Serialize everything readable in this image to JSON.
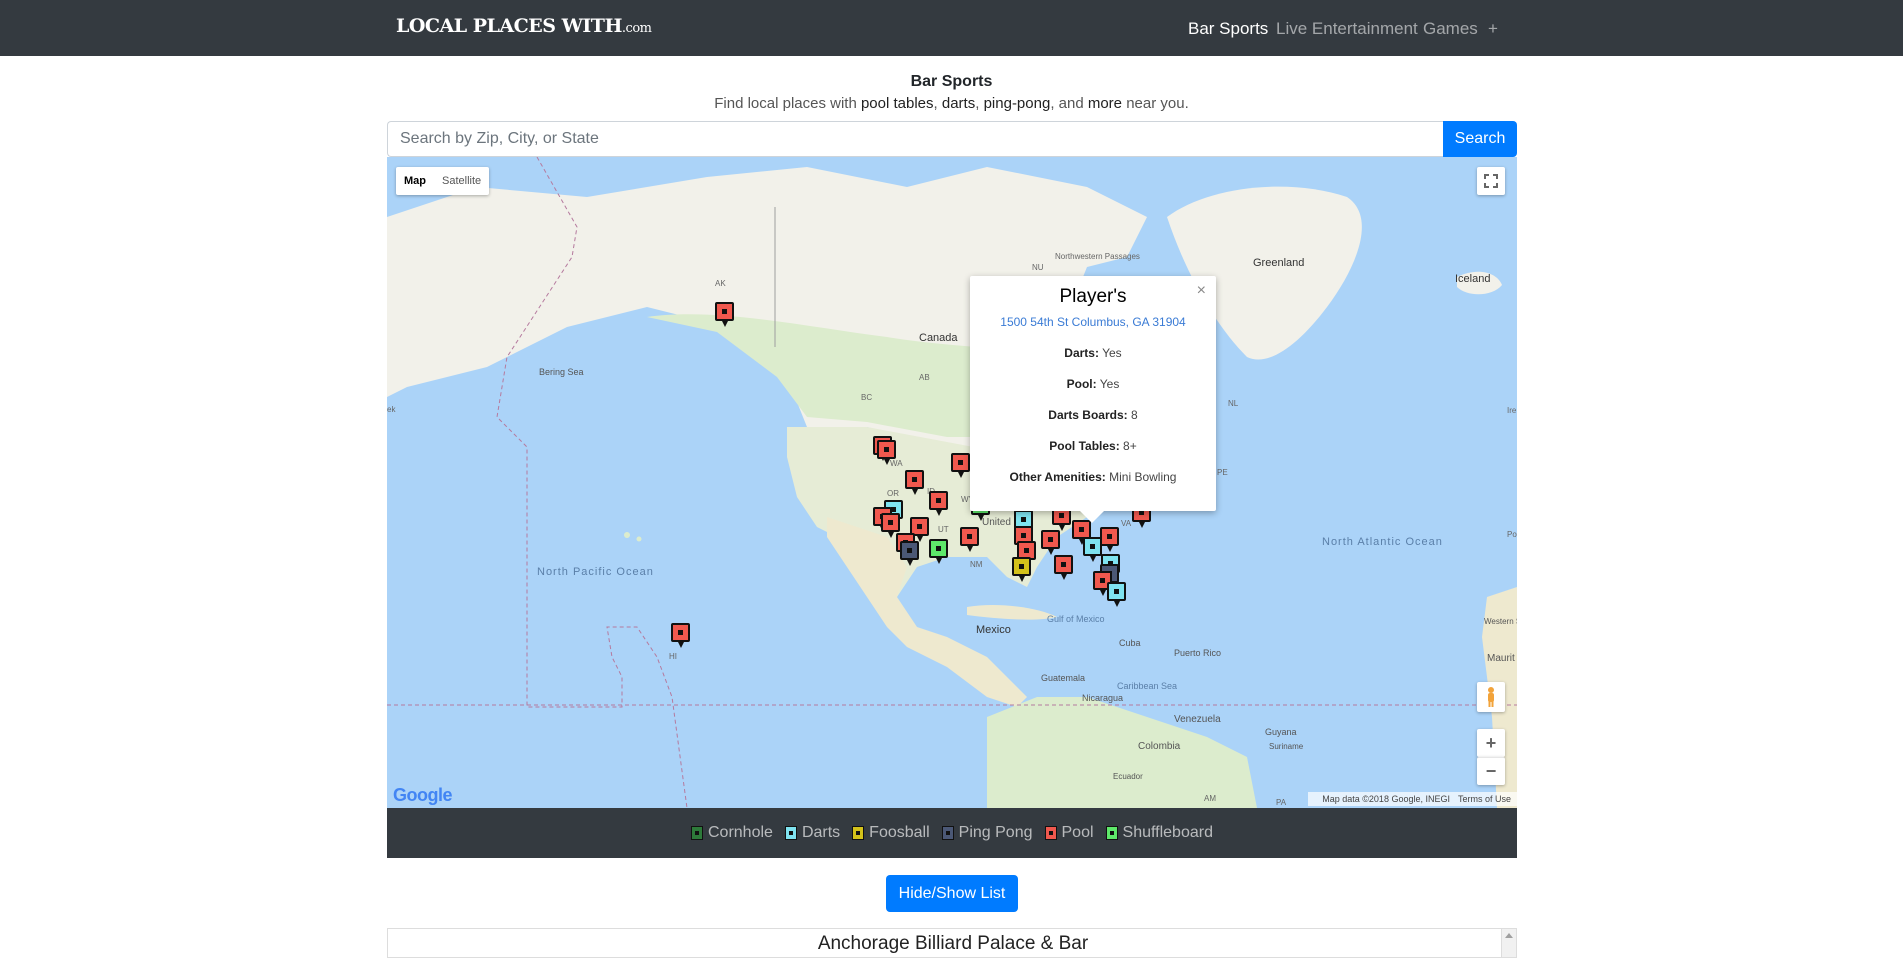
{
  "brand": {
    "name": "LOCAL PLACES WITH",
    "tld": ".com"
  },
  "nav": {
    "items": [
      {
        "label": "Bar Sports",
        "active": true
      },
      {
        "label": "Live Entertainment"
      },
      {
        "label": "Games"
      },
      {
        "label": "+"
      }
    ]
  },
  "header": {
    "title": "Bar Sports",
    "tagline_prefix": "Find local places with ",
    "tag1": "pool tables",
    "sep1": ", ",
    "tag2": "darts",
    "sep2": ", ",
    "tag3": "ping-pong",
    "sep3": ", and ",
    "tag4": "more",
    "tagline_suffix": " near you."
  },
  "search": {
    "placeholder": "Search by Zip, City, or State",
    "button_label": "Search"
  },
  "map": {
    "type_map": "Map",
    "type_satellite": "Satellite",
    "fullscreen_icon": "fullscreen-icon",
    "pegman_icon": "pegman-icon",
    "zoom_in": "+",
    "zoom_out": "−",
    "logo": "Google",
    "attribution": "Map data ©2018 Google, INEGI",
    "terms": "Terms of Use",
    "labels": {
      "greenland": "Greenland",
      "iceland": "Iceland",
      "canada": "Canada",
      "nw_passages": "Northwestern Passages",
      "bering_sea": "Bering Sea",
      "north_pacific": "North Pacific Ocean",
      "north_atlantic": "North Atlantic Ocean",
      "mexico": "Mexico",
      "gulf_of_mexico": "Gulf of Mexico",
      "cuba": "Cuba",
      "puerto_rico": "Puerto Rico",
      "caribbean_sea": "Caribbean Sea",
      "guatemala": "Guatemala",
      "nicaragua": "Nicaragua",
      "venezuela": "Venezuela",
      "colombia": "Colombia",
      "guyana": "Guyana",
      "suriname": "Suriname",
      "ecuador": "Ecuador",
      "western_sahara": "Western Sahara",
      "maurit": "Maurit",
      "united_states": "United St",
      "ak": "AK",
      "bc": "BC",
      "ab": "AB",
      "nu": "NU",
      "wa": "WA",
      "or": "OR",
      "id": "ID",
      "wy": "WY",
      "ut": "UT",
      "nm": "NM",
      "hi": "HI",
      "va": "VA",
      "pe": "PE",
      "nl": "NL",
      "am": "AM",
      "pa": "PA",
      "fk": "ek",
      "ire": "Ire",
      "po": "Po"
    }
  },
  "popup": {
    "title": "Player's",
    "address": "1500 54th St Columbus, GA 31904",
    "close": "×",
    "rows": [
      {
        "label": "Darts:",
        "value": "Yes"
      },
      {
        "label": "Pool:",
        "value": "Yes"
      },
      {
        "label": "Darts Boards:",
        "value": "8"
      },
      {
        "label": "Pool Tables:",
        "value": "8+"
      },
      {
        "label": "Other Amenities:",
        "value": "Mini Bowling"
      }
    ]
  },
  "legend": {
    "items": [
      {
        "label": "Cornhole",
        "color": "#2d7a3a"
      },
      {
        "label": "Darts",
        "color": "#7fe3f0"
      },
      {
        "label": "Foosball",
        "color": "#d4c21a"
      },
      {
        "label": "Ping Pong",
        "color": "#4b5876"
      },
      {
        "label": "Pool",
        "color": "#f0584e"
      },
      {
        "label": "Shuffleboard",
        "color": "#5ee86a"
      }
    ]
  },
  "colors": {
    "pool": "#f0584e",
    "darts": "#7fe3f0",
    "foosball": "#d4c21a",
    "ping_pong": "#4b5876",
    "shuffleboard": "#5ee86a",
    "cornhole": "#2d7a3a",
    "brand_blue": "#007bff",
    "nav_bg": "#343a40"
  },
  "list_toggle_label": "Hide/Show List",
  "list": {
    "first_item": "Anchorage Billiard Palace & Bar"
  }
}
